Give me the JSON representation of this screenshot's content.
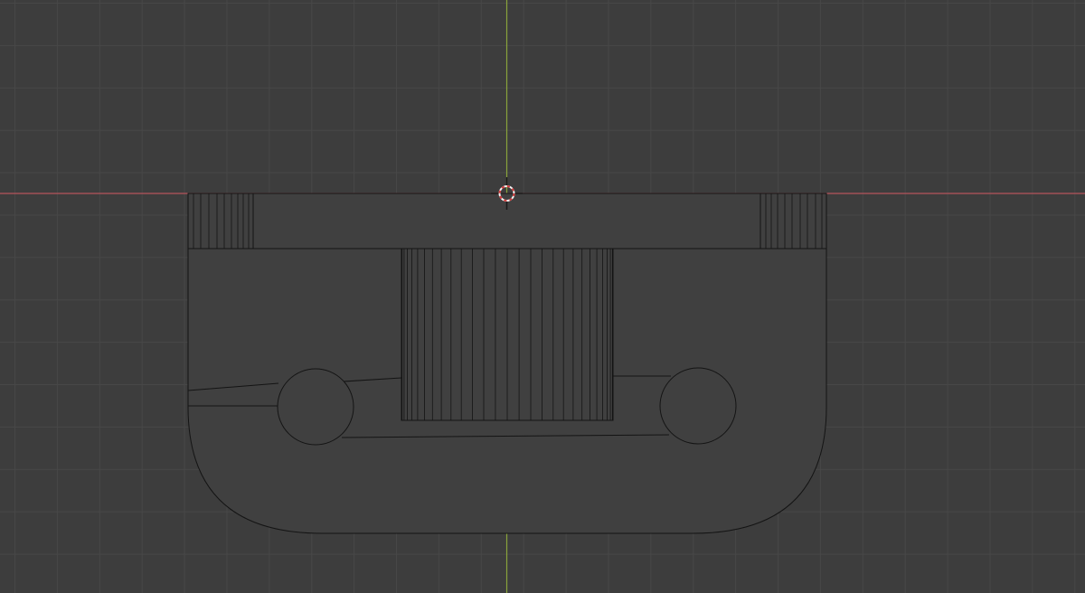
{
  "viewport": {
    "view": "orthographic-front",
    "shading": "wireframe",
    "colors": {
      "background": "#3d3d3d",
      "grid": "#474747",
      "x_axis": "#b5545c",
      "z_axis": "#8aa43c",
      "edge": "#141414",
      "face": "#404040",
      "cursor_ring_red": "#d33a3a",
      "cursor_ring_white": "#f2f2f2"
    },
    "objects": [
      "top-bar",
      "rounded-body",
      "center-cylinder",
      "left-hole",
      "right-hole",
      "left-knurl",
      "right-knurl"
    ],
    "cursor": "3d-cursor-icon"
  }
}
